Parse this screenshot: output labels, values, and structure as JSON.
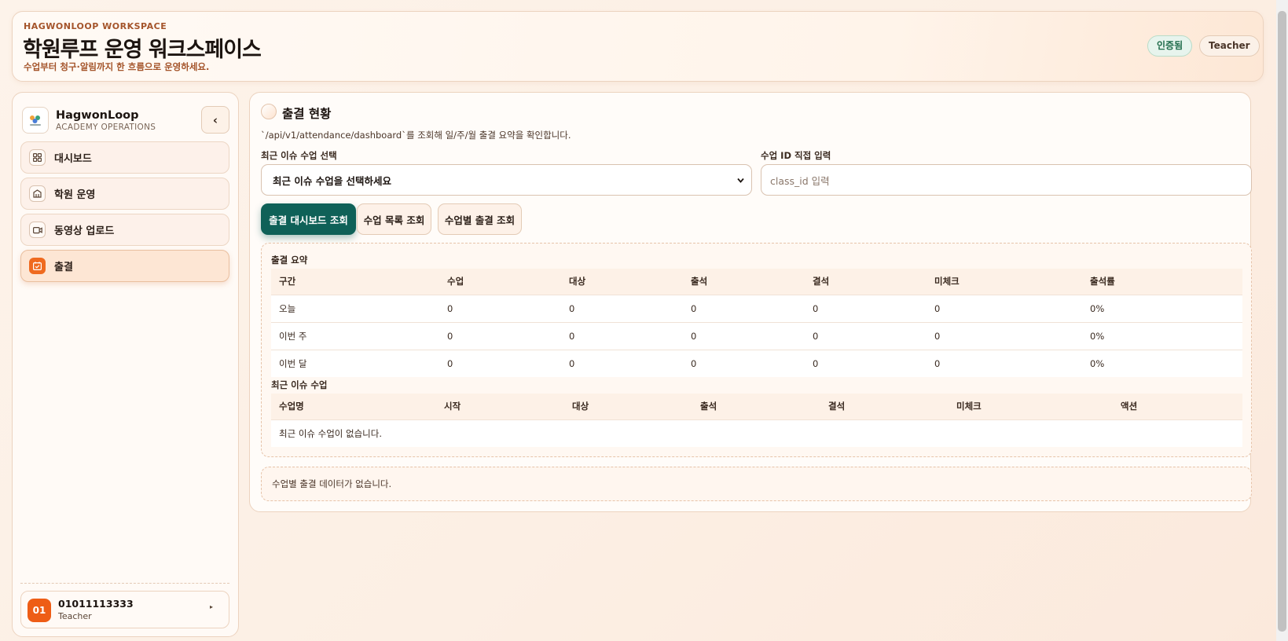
{
  "header": {
    "eyebrow": "HAGWONLOOP WORKSPACE",
    "title": "학원루프 운영 워크스페이스",
    "subtitle": "수업부터 청구·알림까지 한 흐름으로 운영하세요.",
    "verified_badge": "인증됨",
    "role_badge": "Teacher"
  },
  "sidebar": {
    "brand_name": "HagwonLoop",
    "brand_sub": "ACADEMY OPERATIONS",
    "collapse_label": "‹",
    "items": [
      {
        "label": "대시보드",
        "icon": "dashboard-icon",
        "active": false
      },
      {
        "label": "학원 운영",
        "icon": "building-icon",
        "active": false
      },
      {
        "label": "동영상 업로드",
        "icon": "video-icon",
        "active": false
      },
      {
        "label": "출결",
        "icon": "calendar-check-icon",
        "active": true
      }
    ],
    "user": {
      "avatar": "01",
      "phone": "01011113333",
      "role": "Teacher",
      "caret": "▸"
    }
  },
  "attendance": {
    "title": "출결 현황",
    "description": "`/api/v1/attendance/dashboard`를 조회해 일/주/월 출결 요약을 확인합니다.",
    "recent_select_label": "최근 이슈 수업 선택",
    "recent_select_value": "최근 이슈 수업을 선택하세요",
    "class_id_label": "수업 ID 직접 입력",
    "class_id_placeholder": "class_id 입력",
    "buttons": {
      "dashboard": "출결 대시보드 조회",
      "class_list": "수업 목록 조회",
      "by_class": "수업별 출결 조회"
    },
    "summary": {
      "label": "출결 요약",
      "columns": [
        "구간",
        "수업",
        "대상",
        "출석",
        "결석",
        "미체크",
        "출석률"
      ],
      "rows": [
        [
          "오늘",
          "0",
          "0",
          "0",
          "0",
          "0",
          "0%"
        ],
        [
          "이번 주",
          "0",
          "0",
          "0",
          "0",
          "0",
          "0%"
        ],
        [
          "이번 달",
          "0",
          "0",
          "0",
          "0",
          "0",
          "0%"
        ]
      ]
    },
    "recent_issues": {
      "label": "최근 이슈 수업",
      "columns": [
        "수업명",
        "시작",
        "대상",
        "출석",
        "결석",
        "미체크",
        "액션"
      ],
      "empty": "최근 이슈 수업이 없습니다."
    },
    "by_class_empty": "수업별 출결 데이터가 없습니다."
  },
  "colors": {
    "accent": "#ef6a1f",
    "primary_button": "#0f6158",
    "brand_text": "#a4542a",
    "verified": "#1f6b4a"
  }
}
